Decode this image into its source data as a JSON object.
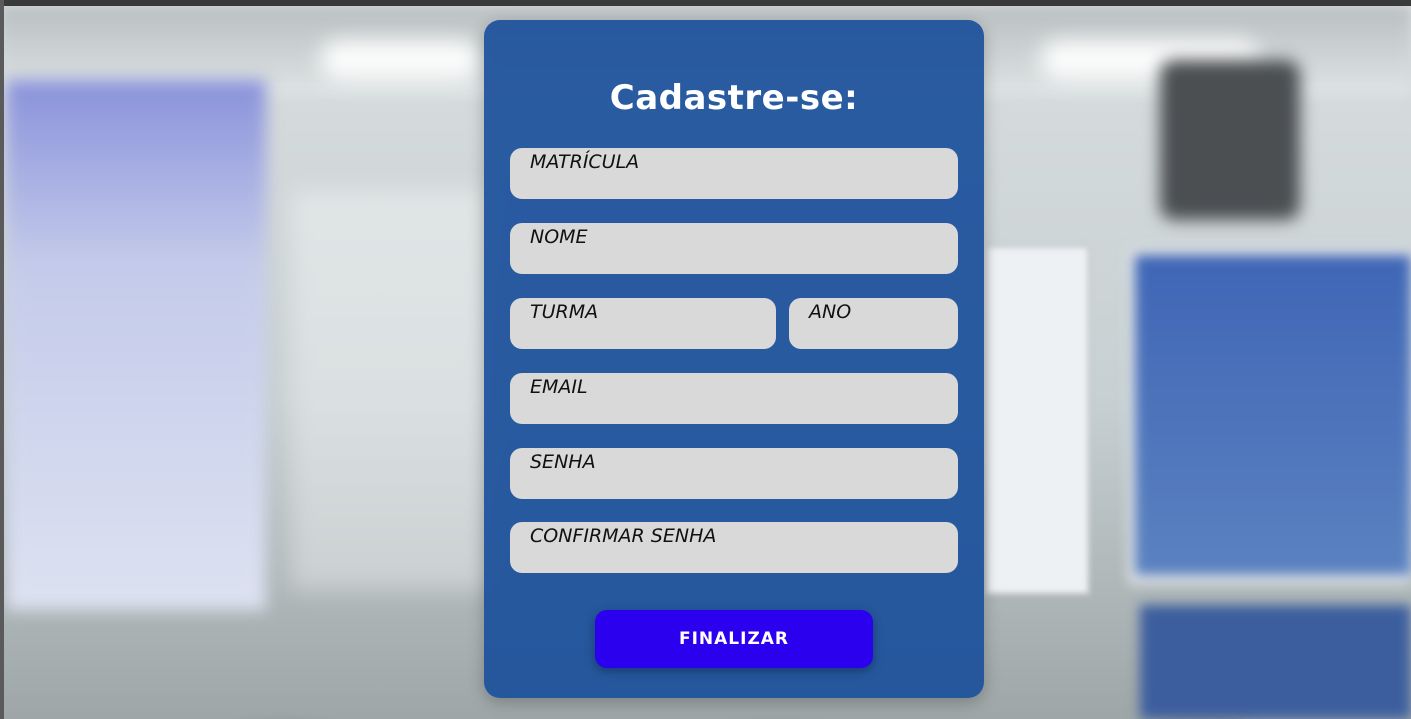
{
  "form": {
    "title": "Cadastre-se:",
    "fields": {
      "matricula": "MATRÍCULA",
      "nome": "NOME",
      "turma": "TURMA",
      "ano": "ANO",
      "email": "EMAIL",
      "senha": "SENHA",
      "confirmar_senha": "CONFIRMAR SENHA"
    },
    "submit_label": "FINALIZAR"
  },
  "colors": {
    "card_background": "#1c519c",
    "field_background": "#d9d9d9",
    "button_background": "#2a00ef",
    "title_text": "#ffffff"
  }
}
